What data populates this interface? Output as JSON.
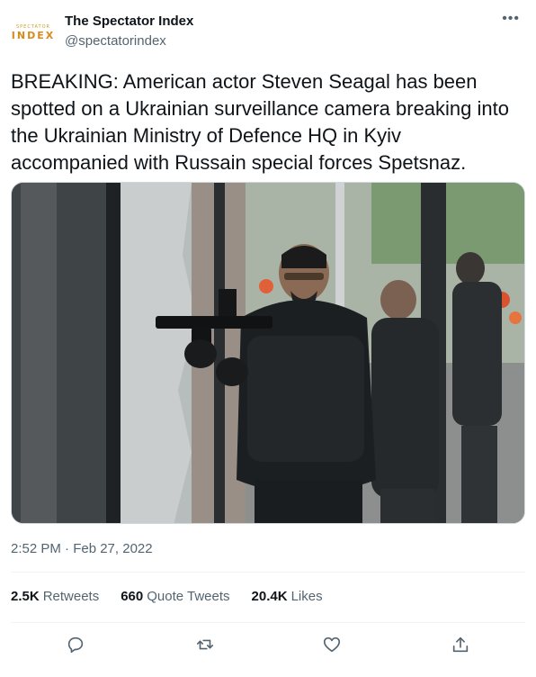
{
  "account": {
    "display_name": "The Spectator Index",
    "handle": "@spectatorindex",
    "logo_small_text": "SPECTATOR",
    "logo_big_text": "INDEX"
  },
  "tweet": {
    "text": "BREAKING: American actor Steven Seagal has been spotted on a Ukrainian surveillance camera breaking into the Ukrainian Ministry of Defence HQ in Kyiv accompanied with Russain special forces Spetsnaz.",
    "timestamp": "2:52 PM · Feb 27, 2022"
  },
  "stats": {
    "retweets_count": "2.5K",
    "retweets_label": "Retweets",
    "quotes_count": "660",
    "quotes_label": "Quote Tweets",
    "likes_count": "20.4K",
    "likes_label": "Likes"
  },
  "icons": {
    "more": "more-icon",
    "reply": "reply-icon",
    "retweet": "retweet-icon",
    "like": "heart-icon",
    "share": "share-icon"
  },
  "colors": {
    "text_primary": "#0f1419",
    "text_secondary": "#536471",
    "divider": "#eff3f4",
    "logo_accent": "#d98a1a"
  }
}
